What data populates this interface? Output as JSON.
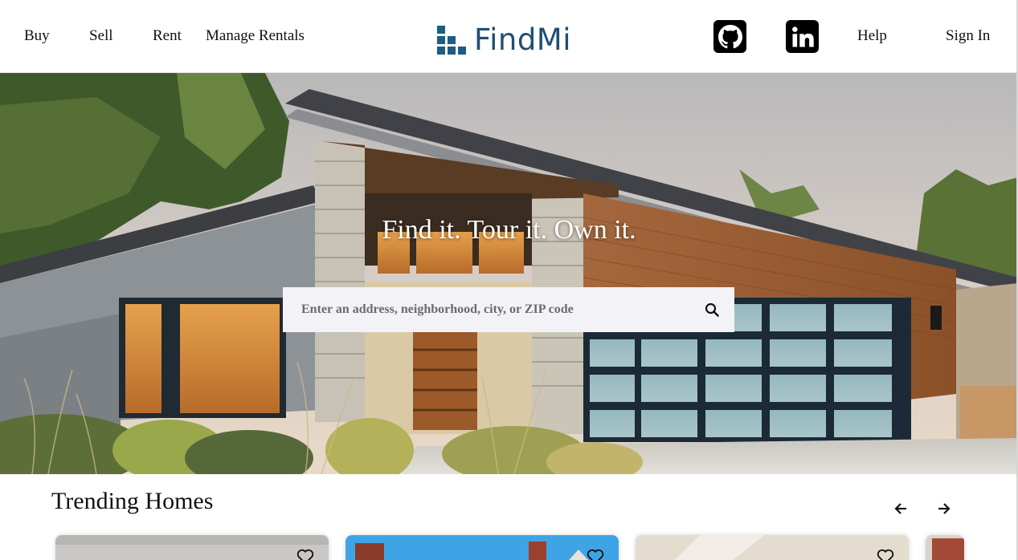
{
  "nav": {
    "left": [
      {
        "label": "Buy"
      },
      {
        "label": "Sell"
      },
      {
        "label": "Rent"
      },
      {
        "label": "Manage Rentals"
      }
    ],
    "right": [
      {
        "label": "Help"
      },
      {
        "label": "Sign In"
      }
    ]
  },
  "logo": {
    "text": "FindMi",
    "color": "#1f4f73"
  },
  "social": [
    {
      "icon": "github-icon"
    },
    {
      "icon": "linkedin-icon"
    }
  ],
  "hero": {
    "title": "Find it. Tour it. Own it.",
    "search": {
      "placeholder": "Enter an address, neighborhood, city, or ZIP code",
      "value": ""
    }
  },
  "trending": {
    "title": "Trending Homes",
    "prev_icon": "arrow-left-icon",
    "next_icon": "arrow-right-icon",
    "cards": [
      {
        "image": "interior-gray"
      },
      {
        "image": "brick-house-blue-sky"
      },
      {
        "image": "interior-beige"
      },
      {
        "image": "brick-house-partial"
      }
    ]
  }
}
